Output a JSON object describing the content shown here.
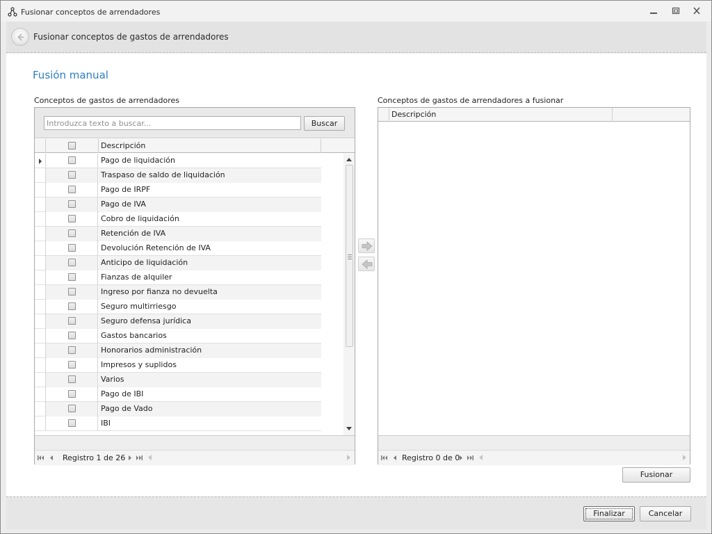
{
  "window": {
    "title": "Fusionar conceptos de arrendadores",
    "controls": [
      "minimize-icon",
      "restore-icon",
      "close-icon"
    ]
  },
  "header": {
    "title": "Fusionar conceptos de gastos de arrendadores",
    "back_icon": "back-arrow-icon"
  },
  "section_title": "Fusión manual",
  "left_panel": {
    "label": "Conceptos de gastos de arrendadores",
    "search_placeholder": "Introduzca texto a buscar...",
    "search_value": "",
    "search_button": "Buscar",
    "column_description": "Descripción",
    "rows": [
      "Pago de liquidación",
      "Traspaso de saldo de liquidación",
      "Pago de IRPF",
      "Pago de IVA",
      "Cobro de liquidación",
      "Retención de IVA",
      "Devolución Retención de IVA",
      "Anticipo de liquidación",
      "Fianzas de alquiler",
      "Ingreso por fianza no devuelta",
      "Seguro multirriesgo",
      "Seguro defensa jurídica",
      "Gastos bancarios",
      "Honorarios administración",
      "Impresos y suplidos",
      "Varios",
      "Pago de IBI",
      "Pago de Vado",
      "IBI"
    ],
    "navigator_text": "Registro 1 de 26"
  },
  "right_panel": {
    "label": "Conceptos de gastos de arrendadores a fusionar",
    "column_description": "Descripción",
    "navigator_text": "Registro 0 de 0"
  },
  "buttons": {
    "move_right_icon": "arrow-right-icon",
    "move_left_icon": "arrow-left-icon",
    "merge": "Fusionar",
    "finish": "Finalizar",
    "cancel": "Cancelar"
  },
  "colors": {
    "section_title": "#2e7fbf",
    "alt_row": "#f3f3f3"
  }
}
